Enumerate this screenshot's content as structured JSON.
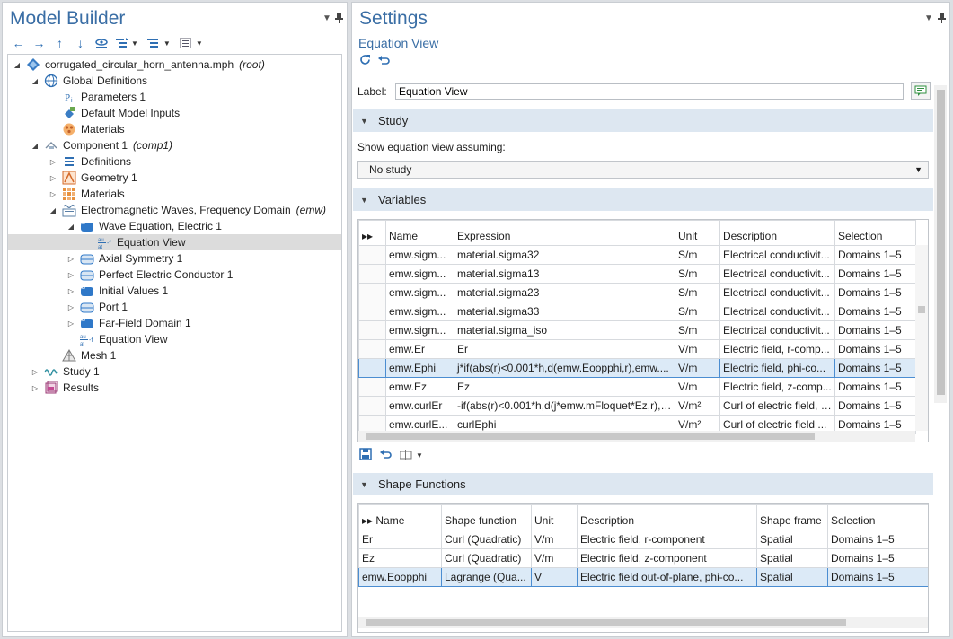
{
  "model_builder": {
    "title": "Model Builder",
    "tree": [
      {
        "label": "corrugated_circular_horn_antenna.mph",
        "tag": "(root)",
        "icon": "model-file-icon",
        "depth": 0,
        "toggle": "expanded"
      },
      {
        "label": "Global Definitions",
        "tag": "",
        "icon": "globe-icon",
        "depth": 1,
        "toggle": "expanded"
      },
      {
        "label": "Parameters 1",
        "tag": "",
        "icon": "parameters-icon",
        "depth": 2,
        "toggle": "none"
      },
      {
        "label": "Default Model Inputs",
        "tag": "",
        "icon": "model-inputs-icon",
        "depth": 2,
        "toggle": "none"
      },
      {
        "label": "Materials",
        "tag": "",
        "icon": "materials-icon",
        "depth": 2,
        "toggle": "none"
      },
      {
        "label": "Component 1",
        "tag": "(comp1)",
        "icon": "component-icon",
        "depth": 1,
        "toggle": "expanded"
      },
      {
        "label": "Definitions",
        "tag": "",
        "icon": "definitions-icon",
        "depth": 2,
        "toggle": "collapsed"
      },
      {
        "label": "Geometry 1",
        "tag": "",
        "icon": "geometry-icon",
        "depth": 2,
        "toggle": "collapsed"
      },
      {
        "label": "Materials",
        "tag": "",
        "icon": "materials-grid-icon",
        "depth": 2,
        "toggle": "collapsed"
      },
      {
        "label": "Electromagnetic Waves, Frequency Domain",
        "tag": "(emw)",
        "icon": "physics-emw-icon",
        "depth": 2,
        "toggle": "expanded"
      },
      {
        "label": "Wave Equation, Electric 1",
        "tag": "",
        "icon": "domain-feature-icon",
        "depth": 3,
        "toggle": "expanded"
      },
      {
        "label": "Equation View",
        "tag": "",
        "icon": "equation-view-icon",
        "depth": 4,
        "toggle": "none",
        "selected": true
      },
      {
        "label": "Axial Symmetry 1",
        "tag": "",
        "icon": "boundary-feature-icon",
        "depth": 3,
        "toggle": "collapsed"
      },
      {
        "label": "Perfect Electric Conductor 1",
        "tag": "",
        "icon": "boundary-feature-icon",
        "depth": 3,
        "toggle": "collapsed"
      },
      {
        "label": "Initial Values 1",
        "tag": "",
        "icon": "domain-feature-icon",
        "depth": 3,
        "toggle": "collapsed"
      },
      {
        "label": "Port 1",
        "tag": "",
        "icon": "boundary-feature-icon",
        "depth": 3,
        "toggle": "collapsed"
      },
      {
        "label": "Far-Field Domain 1",
        "tag": "",
        "icon": "domain-feature-icon",
        "depth": 3,
        "toggle": "collapsed"
      },
      {
        "label": "Equation View",
        "tag": "",
        "icon": "equation-view-icon",
        "depth": 3,
        "toggle": "none"
      },
      {
        "label": "Mesh 1",
        "tag": "",
        "icon": "mesh-icon",
        "depth": 2,
        "toggle": "none"
      },
      {
        "label": "Study 1",
        "tag": "",
        "icon": "study-icon",
        "depth": 1,
        "toggle": "collapsed"
      },
      {
        "label": "Results",
        "tag": "",
        "icon": "results-icon",
        "depth": 1,
        "toggle": "collapsed"
      }
    ]
  },
  "settings": {
    "title": "Settings",
    "subtitle": "Equation View",
    "label_caption": "Label:",
    "label_value": "Equation View",
    "study_section": "Study",
    "study_caption": "Show equation view assuming:",
    "study_select": "No study",
    "variables_section": "Variables",
    "variables_columns": [
      "Name",
      "Expression",
      "Unit",
      "Description",
      "Selection"
    ],
    "variables_rows": [
      [
        "emw.sigm...",
        "material.sigma32",
        "S/m",
        "Electrical conductivit...",
        "Domains 1–5"
      ],
      [
        "emw.sigm...",
        "material.sigma13",
        "S/m",
        "Electrical conductivit...",
        "Domains 1–5"
      ],
      [
        "emw.sigm...",
        "material.sigma23",
        "S/m",
        "Electrical conductivit...",
        "Domains 1–5"
      ],
      [
        "emw.sigm...",
        "material.sigma33",
        "S/m",
        "Electrical conductivit...",
        "Domains 1–5"
      ],
      [
        "emw.sigm...",
        "material.sigma_iso",
        "S/m",
        "Electrical conductivit...",
        "Domains 1–5"
      ],
      [
        "emw.Er",
        "Er",
        "V/m",
        "Electric field, r-comp...",
        "Domains 1–5"
      ],
      [
        "emw.Ephi",
        "j*if(abs(r)<0.001*h,d(emw.Eoopphi,r),emw....",
        "V/m",
        "Electric field, phi-co...",
        "Domains 1–5"
      ],
      [
        "emw.Ez",
        "Ez",
        "V/m",
        "Electric field, z-comp...",
        "Domains 1–5"
      ],
      [
        "emw.curlEr",
        "-if(abs(r)<0.001*h,d(j*emw.mFloquet*Ez,r),e...",
        "V/m²",
        "Curl of electric field, r...",
        "Domains 1–5"
      ],
      [
        "emw.curlE...",
        "curlEphi",
        "V/m²",
        "Curl of electric field ...",
        "Domains 1–5"
      ]
    ],
    "variables_selected_row": 6,
    "shape_section": "Shape Functions",
    "shape_columns": [
      "Name",
      "Shape function",
      "Unit",
      "Description",
      "Shape frame",
      "Selection"
    ],
    "shape_rows": [
      [
        "Er",
        "Curl (Quadratic)",
        "V/m",
        "Electric field, r-component",
        "Spatial",
        "Domains 1–5"
      ],
      [
        "Ez",
        "Curl (Quadratic)",
        "V/m",
        "Electric field, z-component",
        "Spatial",
        "Domains 1–5"
      ],
      [
        "emw.Eoopphi",
        "Lagrange (Qua...",
        "V",
        "Electric field out-of-plane, phi-co...",
        "Spatial",
        "Domains 1–5"
      ]
    ],
    "shape_selected_row": 2
  }
}
